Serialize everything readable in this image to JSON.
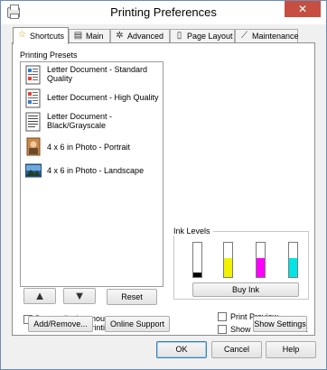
{
  "window": {
    "title": "Printing Preferences",
    "close_glyph": "✕"
  },
  "tabs": [
    {
      "label": "Shortcuts",
      "icon": "star-icon",
      "glyph": "☆"
    },
    {
      "label": "Main",
      "icon": "printer-icon",
      "glyph": "▤"
    },
    {
      "label": "Advanced",
      "icon": "gear-icon",
      "glyph": "✲"
    },
    {
      "label": "Page Layout",
      "icon": "page-icon",
      "glyph": "▯"
    },
    {
      "label": "Maintenance",
      "icon": "wrench-icon",
      "glyph": "⟋"
    }
  ],
  "presets": {
    "label": "Printing Presets",
    "items": [
      {
        "label": "Letter Document - Standard Quality",
        "icon": "document-color-icon"
      },
      {
        "label": "Letter Document - High Quality",
        "icon": "document-high-quality-icon"
      },
      {
        "label": "Letter Document - Black/Grayscale",
        "icon": "document-grayscale-icon"
      },
      {
        "label": "4 x 6 in Photo - Portrait",
        "icon": "photo-portrait-icon"
      },
      {
        "label": "4 x 6 in Photo - Landscape",
        "icon": "photo-landscape-icon"
      }
    ]
  },
  "list_controls": {
    "up_glyph": "▲",
    "down_glyph": "▼",
    "reset_label": "Reset"
  },
  "ink": {
    "title": "Ink Levels",
    "levels": [
      {
        "color_name": "Black",
        "color": "#000000",
        "fraction": 0.12
      },
      {
        "color_name": "Yellow",
        "color": "#f2f200",
        "fraction": 0.55
      },
      {
        "color_name": "Magenta",
        "color": "#ff00ff",
        "fraction": 0.55
      },
      {
        "color_name": "Cyan",
        "color": "#00e5e5",
        "fraction": 0.55
      }
    ],
    "buy_label": "Buy Ink"
  },
  "options": {
    "mouseover_label": "Do not display mouse-over messages for Printing Presets.",
    "print_preview_label": "Print Preview",
    "show_screen_first_label": "Show this screen first",
    "add_remove_label": "Add/Remove...",
    "online_support_label": "Online Support",
    "show_settings_label": "Show Settings"
  },
  "footer": {
    "ok_label": "OK",
    "cancel_label": "Cancel",
    "help_label": "Help"
  }
}
